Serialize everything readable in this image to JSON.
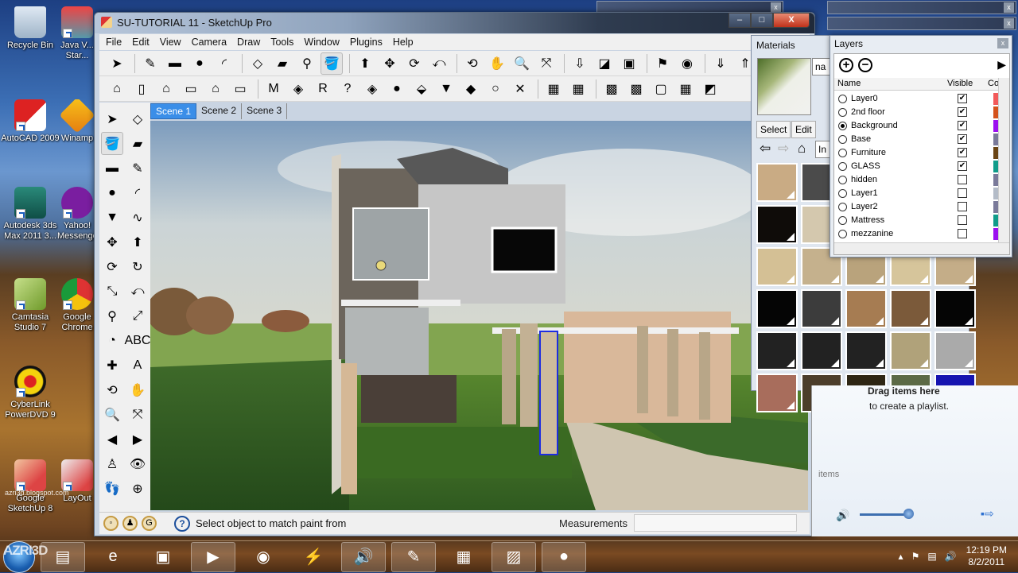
{
  "desktop": {
    "icons": [
      {
        "label": "Recycle Bin",
        "icon": "recycle-bin-icon"
      },
      {
        "label": "Java V... Star...",
        "icon": "java-icon"
      },
      {
        "label": "AutoCAD 2009",
        "icon": "autocad-icon"
      },
      {
        "label": "Winamp",
        "icon": "winamp-icon"
      },
      {
        "label": "Autodesk 3ds Max 2011 3...",
        "icon": "3ds-max-icon"
      },
      {
        "label": "Yahoo! Messenger",
        "icon": "yahoo-messenger-icon"
      },
      {
        "label": "Camtasia Studio 7",
        "icon": "camtasia-icon"
      },
      {
        "label": "Google Chrome",
        "icon": "chrome-icon"
      },
      {
        "label": "CyberLink PowerDVD 9",
        "icon": "powerdvd-icon"
      },
      {
        "label": "Google SketchUp 8",
        "icon": "sketchup-icon"
      },
      {
        "label": "LayOut",
        "icon": "layout-icon"
      }
    ],
    "watermark": "azri3d.blogspot.com",
    "logo_watermark": "AZRI3D"
  },
  "window": {
    "title": "SU-TUTORIAL 11 - SketchUp Pro",
    "minimize": "–",
    "maximize": "□",
    "close": "X"
  },
  "menu": [
    "File",
    "Edit",
    "View",
    "Camera",
    "Draw",
    "Tools",
    "Window",
    "Plugins",
    "Help"
  ],
  "toolbar1": [
    {
      "name": "select-tool",
      "glyph": "➤"
    },
    {
      "name": "pencil-tool",
      "glyph": "✎"
    },
    {
      "name": "rectangle-tool",
      "glyph": "▬"
    },
    {
      "name": "circle-tool",
      "glyph": "●"
    },
    {
      "name": "arc-tool",
      "glyph": "◜"
    },
    {
      "name": "make-component-tool",
      "glyph": "◇"
    },
    {
      "name": "eraser-tool",
      "glyph": "▰"
    },
    {
      "name": "tape-measure-tool",
      "glyph": "⚲"
    },
    {
      "name": "paint-bucket-tool",
      "glyph": "🪣"
    },
    {
      "name": "push-pull-tool",
      "glyph": "⬆"
    },
    {
      "name": "move-tool",
      "glyph": "✥"
    },
    {
      "name": "rotate-tool",
      "glyph": "⟳"
    },
    {
      "name": "offset-tool",
      "glyph": "⤺"
    },
    {
      "name": "orbit-tool",
      "glyph": "⟲"
    },
    {
      "name": "pan-tool",
      "glyph": "✋"
    },
    {
      "name": "zoom-tool",
      "glyph": "🔍"
    },
    {
      "name": "zoom-extents-tool",
      "glyph": "⤧"
    },
    {
      "name": "get-models-tool",
      "glyph": "⇩"
    },
    {
      "name": "share-model-tool",
      "glyph": "◪"
    },
    {
      "name": "photo-textures-tool",
      "glyph": "▣"
    },
    {
      "name": "add-location-tool",
      "glyph": "⚑"
    },
    {
      "name": "google-earth-tool",
      "glyph": "◉"
    },
    {
      "name": "get-component-tool",
      "glyph": "⇓"
    },
    {
      "name": "share-component-tool",
      "glyph": "⇑"
    },
    {
      "name": "preview-in-earth-tool",
      "glyph": "⇧"
    }
  ],
  "toolbar2": [
    {
      "name": "iso-view",
      "glyph": "⌂"
    },
    {
      "name": "right-view",
      "glyph": "▯"
    },
    {
      "name": "front-view",
      "glyph": "⌂"
    },
    {
      "name": "top-view",
      "glyph": "▭"
    },
    {
      "name": "back-view",
      "glyph": "⌂"
    },
    {
      "name": "left-view",
      "glyph": "▭"
    },
    {
      "name": "plugin-m",
      "glyph": "M"
    },
    {
      "name": "plugin-tag-o",
      "glyph": "◈"
    },
    {
      "name": "plugin-r",
      "glyph": "R"
    },
    {
      "name": "plugin-help",
      "glyph": "?"
    },
    {
      "name": "plugin-tag-f",
      "glyph": "◈"
    },
    {
      "name": "sphere-tool",
      "glyph": "●"
    },
    {
      "name": "light-tool",
      "glyph": "⬙"
    },
    {
      "name": "spotlight-tool",
      "glyph": "▼"
    },
    {
      "name": "omni-light-tool",
      "glyph": "◆"
    },
    {
      "name": "sun-tool",
      "glyph": "○"
    },
    {
      "name": "sandbox-tool",
      "glyph": "✕"
    },
    {
      "name": "sandbox-contours",
      "glyph": "▦"
    },
    {
      "name": "sandbox-scratch",
      "glyph": "▦"
    },
    {
      "name": "sandbox-smoove",
      "glyph": "▩"
    },
    {
      "name": "sandbox-stamp",
      "glyph": "▩"
    },
    {
      "name": "sandbox-drape",
      "glyph": "▢"
    },
    {
      "name": "sandbox-detail",
      "glyph": "▦"
    },
    {
      "name": "sandbox-flip-edge",
      "glyph": "◩"
    }
  ],
  "scenes": [
    {
      "label": "Scene 1",
      "active": true
    },
    {
      "label": "Scene 2",
      "active": false
    },
    {
      "label": "Scene 3",
      "active": false
    }
  ],
  "left_tools": [
    {
      "name": "select-tool",
      "glyph": "➤"
    },
    {
      "name": "component-tool",
      "glyph": "◇"
    },
    {
      "name": "paint-bucket-tool",
      "glyph": "🪣"
    },
    {
      "name": "eraser-tool",
      "glyph": "▰"
    },
    {
      "name": "rectangle-tool",
      "glyph": "▬"
    },
    {
      "name": "line-tool",
      "glyph": "✎"
    },
    {
      "name": "circle-tool",
      "glyph": "●"
    },
    {
      "name": "arc-tool",
      "glyph": "◜"
    },
    {
      "name": "polygon-tool",
      "glyph": "▼"
    },
    {
      "name": "freehand-tool",
      "glyph": "∿"
    },
    {
      "name": "move-tool",
      "glyph": "✥"
    },
    {
      "name": "push-pull-tool",
      "glyph": "⬆"
    },
    {
      "name": "rotate-tool",
      "glyph": "⟳"
    },
    {
      "name": "follow-me-tool",
      "glyph": "↻"
    },
    {
      "name": "scale-tool",
      "glyph": "⤡"
    },
    {
      "name": "offset-tool",
      "glyph": "⤺"
    },
    {
      "name": "tape-measure-tool",
      "glyph": "⚲"
    },
    {
      "name": "dimension-tool",
      "glyph": "⤢"
    },
    {
      "name": "protractor-tool",
      "glyph": "◔"
    },
    {
      "name": "text-tool",
      "glyph": "ABC"
    },
    {
      "name": "axes-tool",
      "glyph": "✚"
    },
    {
      "name": "3d-text-tool",
      "glyph": "A"
    },
    {
      "name": "orbit-tool",
      "glyph": "⟲"
    },
    {
      "name": "pan-tool",
      "glyph": "✋"
    },
    {
      "name": "zoom-tool",
      "glyph": "🔍"
    },
    {
      "name": "zoom-window-tool",
      "glyph": "⤧"
    },
    {
      "name": "previous-view-tool",
      "glyph": "◀"
    },
    {
      "name": "next-view-tool",
      "glyph": "▶"
    },
    {
      "name": "position-camera-tool",
      "glyph": "♙"
    },
    {
      "name": "look-around-tool",
      "glyph": "👁"
    },
    {
      "name": "walk-tool",
      "glyph": "👣"
    },
    {
      "name": "section-plane-tool",
      "glyph": "⊕"
    }
  ],
  "status": {
    "message": "Select object to match paint from",
    "measurements_label": "Measurements",
    "measurements_value": ""
  },
  "materials": {
    "title": "Materials",
    "name_value": "na",
    "tabs": [
      "Select",
      "Edit"
    ],
    "library_value": "In",
    "swatch_colors": [
      "#c9ab84",
      "#4b4b4b",
      "#d4c4a4",
      "#d2c3a2",
      "#ccb893",
      "#0f0c09",
      "#d4c8ae",
      "#c8b58f",
      "#c5b48e",
      "#c6b18b",
      "#d4c095",
      "#c5b18d",
      "#b9a37c",
      "#d6c59b",
      "#c4ad88",
      "#050505",
      "#3c3c3c",
      "#a67c52",
      "#7b5a3a",
      "#050505",
      "#222222",
      "#222222",
      "#222222",
      "#b0a27a",
      "#aaaaaa",
      "#a86d5c",
      "#4c3e2b",
      "#2e2614",
      "#5c6a46",
      "#1614b0"
    ]
  },
  "layers": {
    "title": "Layers",
    "columns": {
      "name": "Name",
      "visible": "Visible",
      "color": "Colo"
    },
    "rows": [
      {
        "name": "Layer0",
        "active": false,
        "visible": true,
        "color": "#f25a5a"
      },
      {
        "name": "2nd floor",
        "active": false,
        "visible": true,
        "color": "#d4521c"
      },
      {
        "name": "Background",
        "active": true,
        "visible": true,
        "color": "#9b10f0"
      },
      {
        "name": "Base",
        "active": false,
        "visible": true,
        "color": "#7a7a9a"
      },
      {
        "name": "Furniture",
        "active": false,
        "visible": true,
        "color": "#6a4414"
      },
      {
        "name": "GLASS",
        "active": false,
        "visible": true,
        "color": "#109c8a"
      },
      {
        "name": "hidden",
        "active": false,
        "visible": false,
        "color": "#7a7a9a"
      },
      {
        "name": "Layer1",
        "active": false,
        "visible": false,
        "color": "#b4bcc8"
      },
      {
        "name": "Layer2",
        "active": false,
        "visible": false,
        "color": "#7a7a9a"
      },
      {
        "name": "Mattress",
        "active": false,
        "visible": false,
        "color": "#109c8a"
      },
      {
        "name": "mezzanine",
        "active": false,
        "visible": false,
        "color": "#9b10f0"
      }
    ]
  },
  "media_player": {
    "drag_text": "Drag items here",
    "create_text": "to create a playlist.",
    "items_text": "items",
    "volume": 0.85
  },
  "taskbar": {
    "apps": [
      {
        "name": "sticky-notes",
        "glyph": "▤",
        "pinned": true
      },
      {
        "name": "internet-explorer",
        "glyph": "e",
        "pinned": false
      },
      {
        "name": "windows-explorer",
        "glyph": "▣",
        "pinned": false
      },
      {
        "name": "media-player",
        "glyph": "▶",
        "pinned": true
      },
      {
        "name": "google-chrome",
        "glyph": "◉",
        "pinned": false
      },
      {
        "name": "winamp",
        "glyph": "⚡",
        "pinned": false
      },
      {
        "name": "volume-app",
        "glyph": "🔊",
        "pinned": true
      },
      {
        "name": "sketchup",
        "glyph": "✎",
        "pinned": true
      },
      {
        "name": "calculator",
        "glyph": "▦",
        "pinned": false
      },
      {
        "name": "photo-viewer",
        "glyph": "▨",
        "pinned": true
      },
      {
        "name": "camtasia-recorder",
        "glyph": "●",
        "pinned": true
      }
    ],
    "time": "12:19 PM",
    "date": "8/2/2011"
  }
}
